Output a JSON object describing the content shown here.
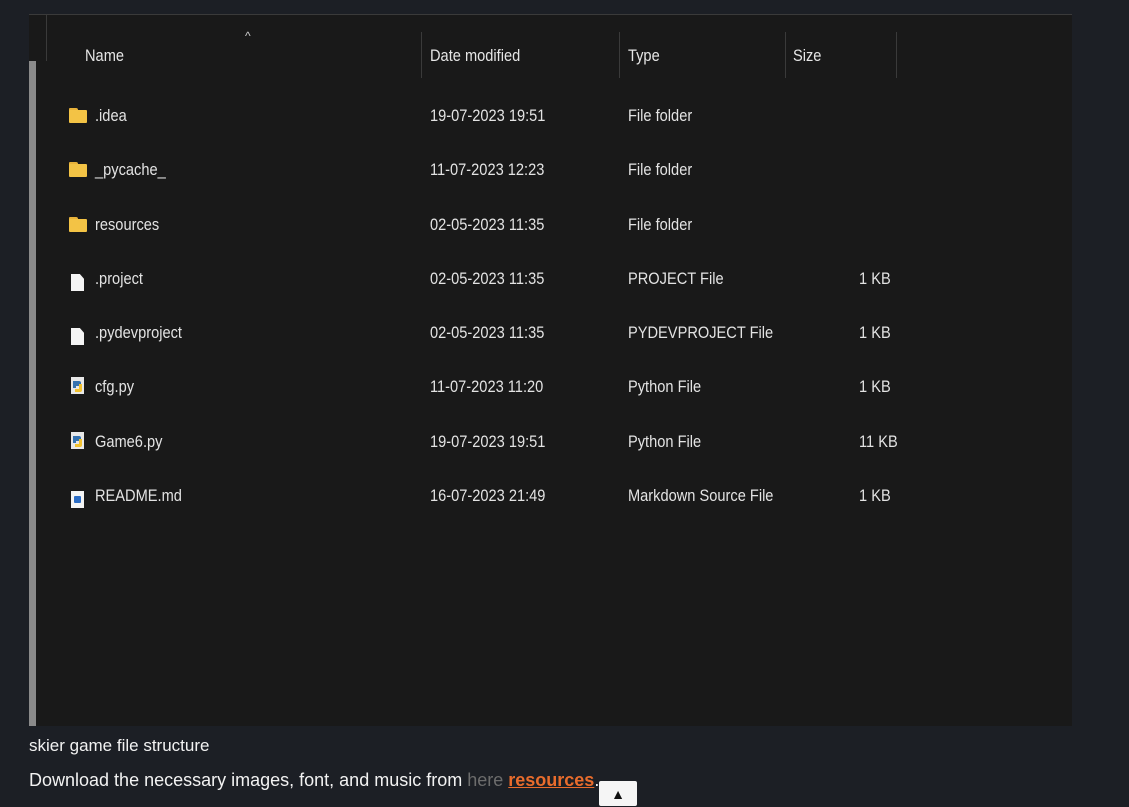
{
  "explorer": {
    "columns": {
      "name": "Name",
      "date": "Date modified",
      "type": "Type",
      "size": "Size",
      "sort_indicator": "^"
    },
    "files": [
      {
        "name": ".idea",
        "date": "19-07-2023 19:51",
        "type": "File folder",
        "size": "",
        "icon": "folder-icon"
      },
      {
        "name": "_pycache_",
        "date": "11-07-2023 12:23",
        "type": "File folder",
        "size": "",
        "icon": "folder-icon"
      },
      {
        "name": "resources",
        "date": "02-05-2023 11:35",
        "type": "File folder",
        "size": "",
        "icon": "folder-icon"
      },
      {
        "name": ".project",
        "date": "02-05-2023 11:35",
        "type": "PROJECT File",
        "size": "1 KB",
        "icon": "file-icon"
      },
      {
        "name": ".pydevproject",
        "date": "02-05-2023 11:35",
        "type": "PYDEVPROJECT File",
        "size": "1 KB",
        "icon": "file-icon"
      },
      {
        "name": "cfg.py",
        "date": "11-07-2023 11:20",
        "type": "Python File",
        "size": "1 KB",
        "icon": "python-file-icon"
      },
      {
        "name": "Game6.py",
        "date": "19-07-2023 19:51",
        "type": "Python File",
        "size": "11 KB",
        "icon": "python-file-icon"
      },
      {
        "name": "README.md",
        "date": "16-07-2023 21:49",
        "type": "Markdown Source File",
        "size": "1 KB",
        "icon": "markdown-file-icon"
      }
    ]
  },
  "caption": "skier game file structure",
  "download": {
    "text_before": "Download the necessary images, font, and music from ",
    "hidden_word": "here",
    "link_text": "resources",
    "text_after": "."
  },
  "scroll_top_label": "▲",
  "colors": {
    "page_background": "#1c1f25",
    "explorer_background": "#191919",
    "link": "#e96c2c",
    "folder": "#f3c345"
  }
}
